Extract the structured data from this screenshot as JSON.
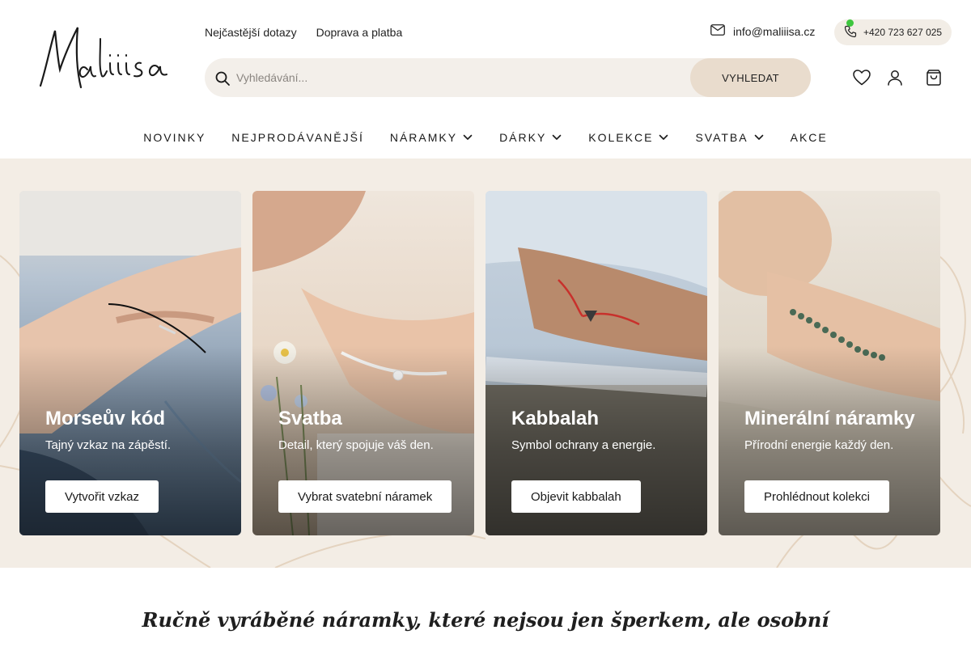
{
  "brand": {
    "logo_text": "Maliiisa"
  },
  "toplinks": {
    "faq": "Nejčastější dotazy",
    "shipping": "Doprava a platba"
  },
  "contact": {
    "email": "info@maliiisa.cz",
    "phone": "+420 723 627 025",
    "phone_status_color": "#3ec63e"
  },
  "search": {
    "placeholder": "Vyhledávání...",
    "button": "VYHLEDAT"
  },
  "header_icons": [
    "heart-icon",
    "user-icon",
    "cart-icon"
  ],
  "nav": [
    {
      "label": "NOVINKY",
      "dropdown": false
    },
    {
      "label": "NEJPRODÁVANĚJŠÍ",
      "dropdown": false
    },
    {
      "label": "NÁRAMKY",
      "dropdown": true
    },
    {
      "label": "DÁRKY",
      "dropdown": true
    },
    {
      "label": "KOLEKCE",
      "dropdown": true
    },
    {
      "label": "SVATBA",
      "dropdown": true
    },
    {
      "label": "AKCE",
      "dropdown": false
    }
  ],
  "cards": [
    {
      "title": "Morseův kód",
      "subtitle": "Tajný vzkaz na zápěstí.",
      "button": "Vytvořit vzkaz"
    },
    {
      "title": "Svatba",
      "subtitle": "Detail, který spojuje váš den.",
      "button": "Vybrat svatební náramek"
    },
    {
      "title": "Kabbalah",
      "subtitle": "Symbol ochrany a energie.",
      "button": "Objevit kabbalah"
    },
    {
      "title": "Minerální náramky",
      "subtitle": "Přírodní energie každý den.",
      "button": "Prohlédnout kolekci"
    }
  ],
  "tagline": "Ručně vyráběné náramky, které nejsou jen šperkem, ale osobní",
  "colors": {
    "band_background": "#f3ede5",
    "search_background": "#f3efea",
    "search_button": "#e9dccd",
    "accent_text": "#1a1a1a"
  }
}
